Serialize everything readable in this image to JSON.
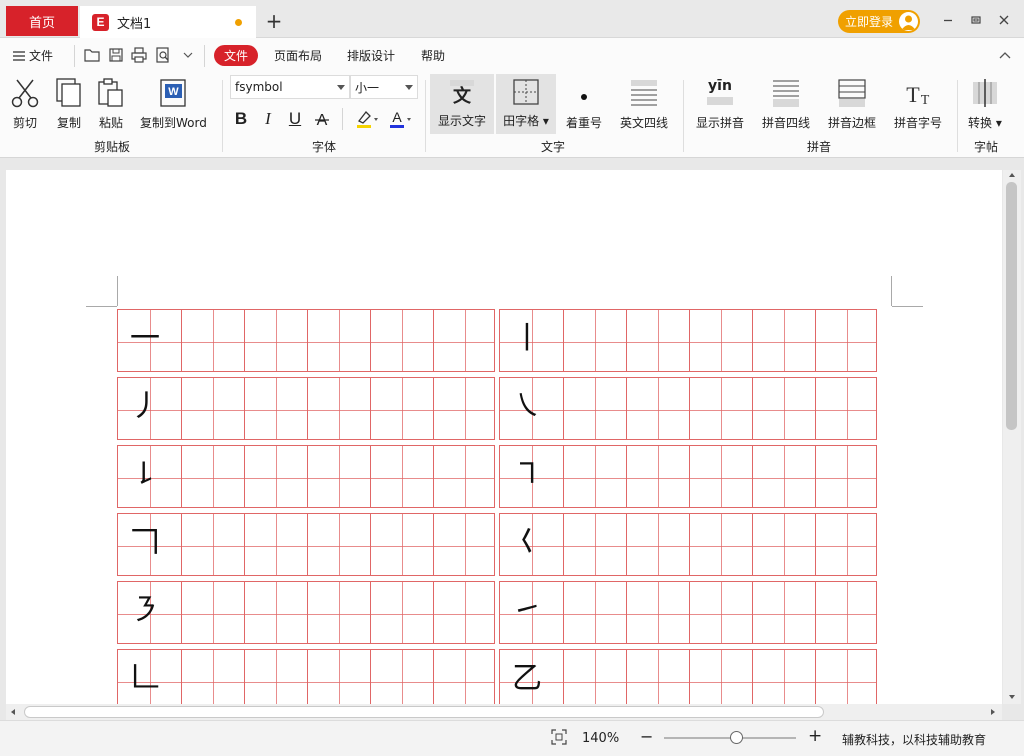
{
  "tabs": {
    "home": "首页",
    "document": "文档1"
  },
  "login_label": "立即登录",
  "menu": {
    "file_menu": "文件",
    "items": [
      "文件",
      "页面布局",
      "排版设计",
      "帮助"
    ]
  },
  "ribbon": {
    "clipboard": {
      "cut": "剪切",
      "copy": "复制",
      "paste": "粘贴",
      "copy_to_word": "复制到Word",
      "group": "剪贴板"
    },
    "font": {
      "font_name": "fsymbol",
      "font_size": "小一",
      "group": "字体"
    },
    "text": {
      "show_text": "显示文字",
      "grid": "田字格",
      "emphasis": "着重号",
      "four_lines": "英文四线",
      "group": "文字"
    },
    "pinyin": {
      "yin_sample": "yīn",
      "show_pinyin": "显示拼音",
      "pinyin_four_lines": "拼音四线",
      "pinyin_border": "拼音边框",
      "pinyin_size": "拼音字号",
      "group": "拼音"
    },
    "copybook": {
      "convert": "转换",
      "group": "字帖"
    }
  },
  "strokes_left": [
    "一",
    "丿",
    "㇙",
    "𠃍",
    "㇋",
    "𠃊"
  ],
  "strokes_right": [
    "丨",
    "㇏",
    "㇕",
    "𡿨",
    "㇀",
    "乙"
  ],
  "statusbar": {
    "zoom": "140%",
    "zoom_level": 0.55,
    "info": "辅教科技，以科技辅助教育"
  },
  "colors": {
    "brand": "#d7222a",
    "accent": "#f0a000",
    "grid": "#e06666"
  }
}
